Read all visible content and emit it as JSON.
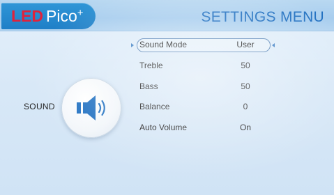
{
  "header": {
    "brand": "LED",
    "model": "Pico",
    "model_sup": "+",
    "menu_title": "SETTINGS MENU"
  },
  "section": {
    "label": "SOUND",
    "icon": "speaker-volume-icon"
  },
  "settings": [
    {
      "label": "Sound Mode",
      "value": "User",
      "selected": true
    },
    {
      "label": "Treble",
      "value": "50"
    },
    {
      "label": "Bass",
      "value": "50"
    },
    {
      "label": "Balance",
      "value": "0"
    },
    {
      "label": "Auto Volume",
      "value": "On"
    }
  ],
  "colors": {
    "brand_red": "#e0223c",
    "accent_blue": "#1f6fc0",
    "logo_bg": "#2f96d7",
    "icon_blue": "#1e6fc1"
  }
}
